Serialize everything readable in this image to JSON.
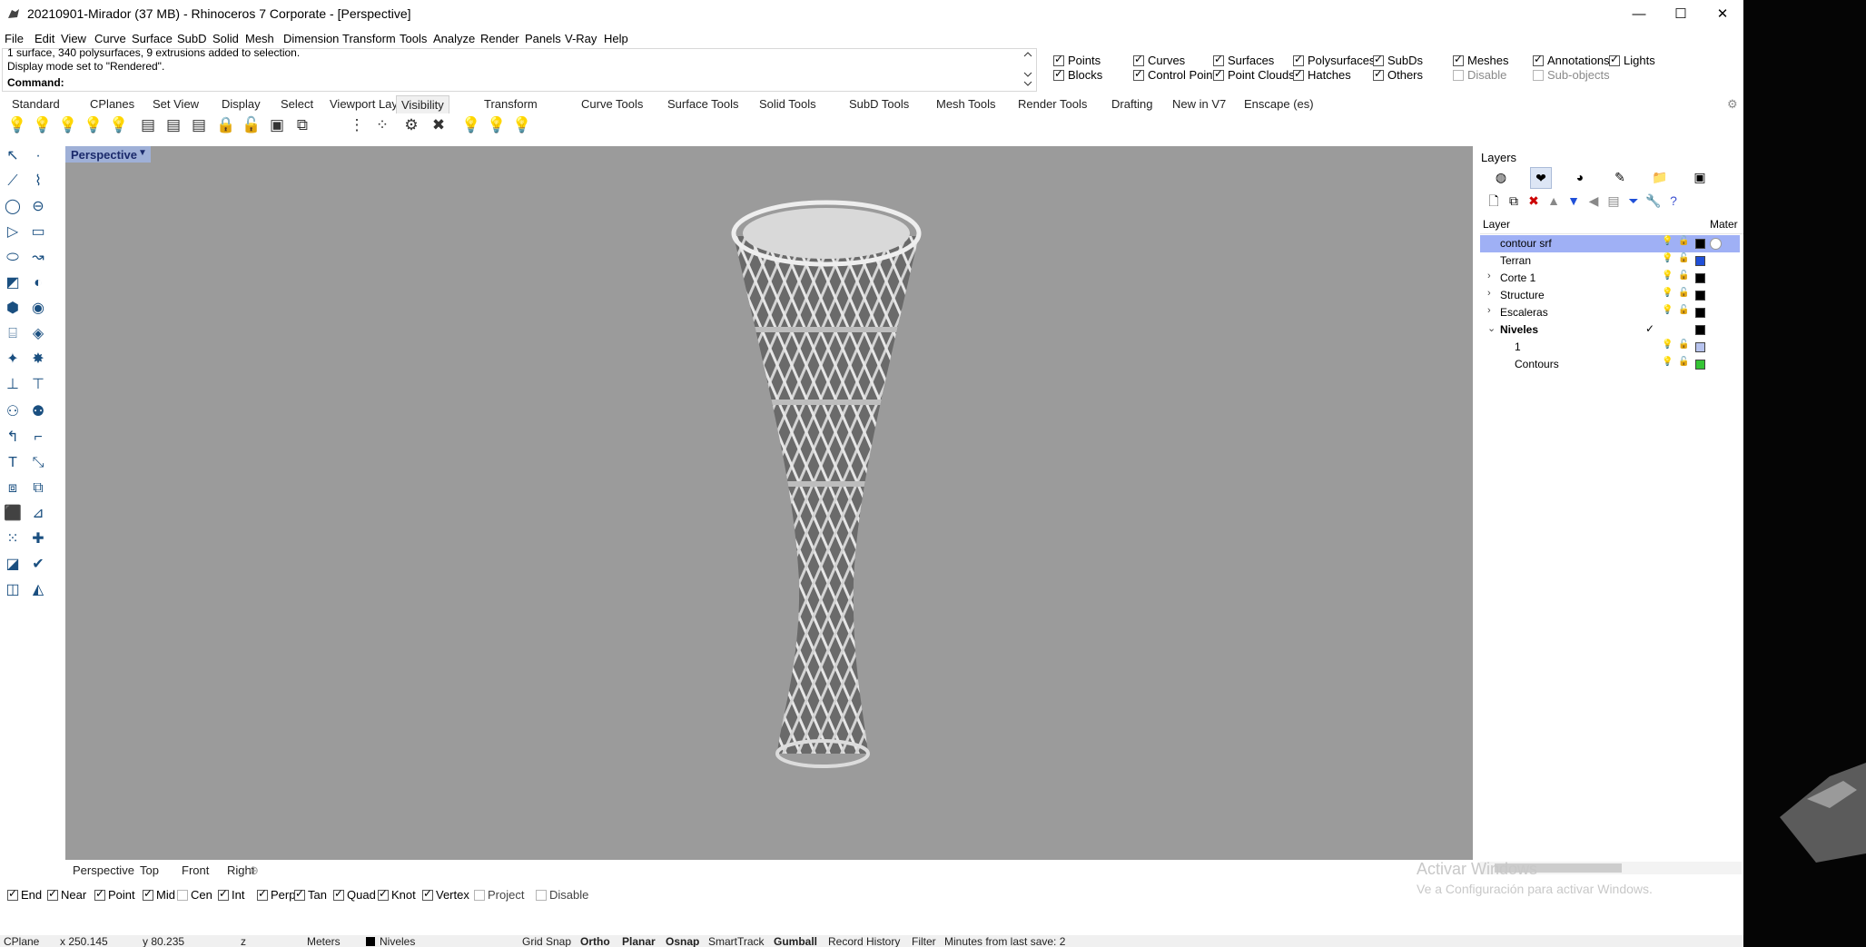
{
  "window": {
    "title": "20210901-Mirador (37 MB) - Rhinoceros 7 Corporate - [Perspective]",
    "minimize": "—",
    "maximize": "☐",
    "close": "✕"
  },
  "menu": [
    "File",
    "Edit",
    "View",
    "Curve",
    "Surface",
    "SubD",
    "Solid",
    "Mesh",
    "Dimension",
    "Transform",
    "Tools",
    "Analyze",
    "Render",
    "Panels",
    "V-Ray",
    "Help"
  ],
  "command": {
    "history": [
      "1 surface, 340 polysurfaces, 9 extrusions added to selection.",
      "Display mode set to \"Rendered\"."
    ],
    "label": "Command:",
    "value": ""
  },
  "visibility": [
    {
      "label": "Points",
      "checked": true
    },
    {
      "label": "Curves",
      "checked": true
    },
    {
      "label": "Surfaces",
      "checked": true
    },
    {
      "label": "Polysurfaces",
      "checked": true
    },
    {
      "label": "SubDs",
      "checked": true
    },
    {
      "label": "Meshes",
      "checked": true
    },
    {
      "label": "Annotations",
      "checked": true
    },
    {
      "label": "Lights",
      "checked": true
    },
    {
      "label": "Blocks",
      "checked": true
    },
    {
      "label": "Control Points",
      "checked": true
    },
    {
      "label": "Point Clouds",
      "checked": true
    },
    {
      "label": "Hatches",
      "checked": true
    },
    {
      "label": "Others",
      "checked": true
    },
    {
      "label": "Disable",
      "checked": false
    },
    {
      "label": "Sub-objects",
      "checked": false
    }
  ],
  "toolbar_tabs": [
    "Standard",
    "CPlanes",
    "Set View",
    "Display",
    "Select",
    "Viewport Layout",
    "Visibility",
    "Transform",
    "Curve Tools",
    "Surface Tools",
    "Solid Tools",
    "SubD Tools",
    "Mesh Tools",
    "Render Tools",
    "Drafting",
    "New in V7",
    "Enscape (es)"
  ],
  "active_tab": "Visibility",
  "viewport": {
    "label": "Perspective",
    "tabs": [
      "Perspective",
      "Top",
      "Front",
      "Right"
    ],
    "add_tab": "⊕"
  },
  "osnaps": [
    {
      "label": "End",
      "checked": true
    },
    {
      "label": "Near",
      "checked": true
    },
    {
      "label": "Point",
      "checked": true
    },
    {
      "label": "Mid",
      "checked": true
    },
    {
      "label": "Cen",
      "checked": false
    },
    {
      "label": "Int",
      "checked": true
    },
    {
      "label": "Perp",
      "checked": true
    },
    {
      "label": "Tan",
      "checked": true
    },
    {
      "label": "Quad",
      "checked": true
    },
    {
      "label": "Knot",
      "checked": true
    },
    {
      "label": "Vertex",
      "checked": true
    },
    {
      "label": "Project",
      "checked": false
    },
    {
      "label": "Disable",
      "checked": false
    }
  ],
  "status": {
    "cplane": "CPlane",
    "x": "x 250.145",
    "y": "y 80.235",
    "z": "z",
    "units": "Meters",
    "layer": "Niveles",
    "grid_snap": "Grid Snap",
    "ortho": "Ortho",
    "planar": "Planar",
    "osnap": "Osnap",
    "smarttrack": "SmartTrack",
    "gumball": "Gumball",
    "record_history": "Record History",
    "filter": "Filter",
    "minutes": "Minutes from last save: 2"
  },
  "layers_panel": {
    "title": "Layers",
    "col_layer": "Layer",
    "col_material": "Mater",
    "rows": [
      {
        "name": "contour srf",
        "indent": 0,
        "expander": "",
        "selected": true,
        "swatch": "#000000",
        "material": true
      },
      {
        "name": "Terran",
        "indent": 0,
        "expander": "",
        "selected": false,
        "swatch": "#1f4fd8",
        "material": false
      },
      {
        "name": "Corte 1",
        "indent": 0,
        "expander": "›",
        "selected": false,
        "swatch": "#000000",
        "material": false
      },
      {
        "name": "Structure",
        "indent": 0,
        "expander": "›",
        "selected": false,
        "swatch": "#000000",
        "material": false
      },
      {
        "name": "Escaleras",
        "indent": 0,
        "expander": "›",
        "selected": false,
        "swatch": "#000000",
        "material": false
      },
      {
        "name": "Niveles",
        "indent": 0,
        "expander": "⌄",
        "selected": false,
        "swatch": "#000000",
        "material": false,
        "current": true
      },
      {
        "name": "1",
        "indent": 1,
        "expander": "",
        "selected": false,
        "swatch": "#b7c3ee",
        "material": false
      },
      {
        "name": "Contours",
        "indent": 1,
        "expander": "",
        "selected": false,
        "swatch": "#35c435",
        "material": false
      }
    ]
  },
  "watermark": {
    "line1": "Activar Windows",
    "line2": "Ve a Configuración para activar Windows."
  },
  "colors": {
    "viewport_bg": "#9b9b9b",
    "selected_layer": "#9fb0f5",
    "viewport_label_bg": "#9fb0d7"
  }
}
